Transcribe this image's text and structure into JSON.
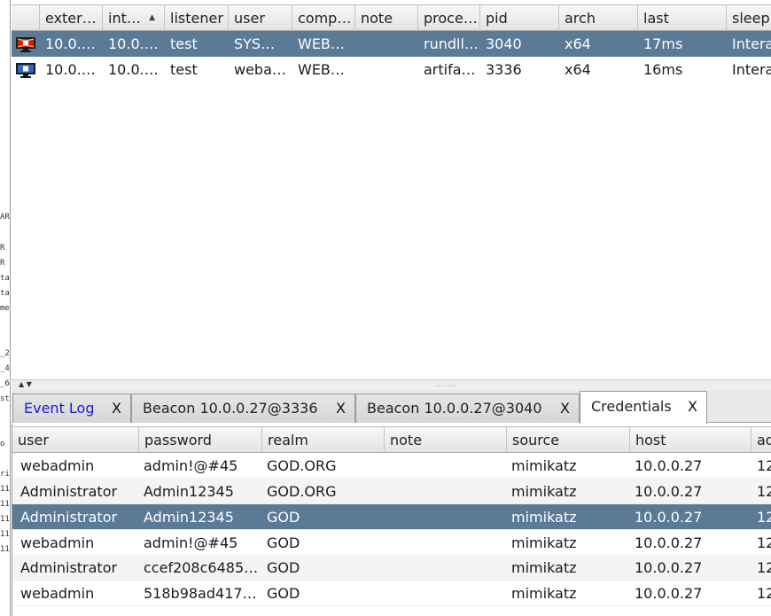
{
  "left_fragments": [
    "AR",
    "R",
    "R",
    "ta",
    "ta",
    "me",
    "_2",
    "_4",
    "_6",
    "st",
    "o",
    "ri",
    "11",
    "11",
    "11",
    "11",
    "11"
  ],
  "beacons": {
    "columns": [
      "exter…",
      "int…",
      "listener",
      "user",
      "comp…",
      "note",
      "proce…",
      "pid",
      "arch",
      "last",
      "sleep"
    ],
    "sort_indicator": "▲",
    "rows": [
      {
        "icon": "beacon-session-admin-icon",
        "external": "10.0.…",
        "internal": "10.0.…",
        "listener": "test",
        "user": "SYS…",
        "computer": "WEB…",
        "note": "",
        "process": "rundll…",
        "pid": "3040",
        "arch": "x64",
        "last": "17ms",
        "sleep": "Intera"
      },
      {
        "icon": "beacon-session-icon",
        "external": "10.0.…",
        "internal": "10.0.…",
        "listener": "test",
        "user": "weba…",
        "computer": "WEB…",
        "note": "",
        "process": "artifa…",
        "pid": "3336",
        "arch": "x64",
        "last": "16ms",
        "sleep": "Intera"
      }
    ]
  },
  "splitter": {
    "arrows": "▲ ▼",
    "grip": "......."
  },
  "tabs": [
    {
      "label": "Event Log",
      "close": "X"
    },
    {
      "label": "Beacon 10.0.0.27@3336",
      "close": "X"
    },
    {
      "label": "Beacon 10.0.0.27@3040",
      "close": "X"
    },
    {
      "label": "Credentials",
      "close": "X"
    }
  ],
  "credentials": {
    "columns": [
      "user",
      "password",
      "realm",
      "note",
      "source",
      "host",
      "ad"
    ],
    "rows": [
      {
        "user": "webadmin",
        "password": "admin!@#45",
        "realm": "GOD.ORG",
        "note": "",
        "source": "mimikatz",
        "host": "10.0.0.27",
        "added": "12"
      },
      {
        "user": "Administrator",
        "password": "Admin12345",
        "realm": "GOD.ORG",
        "note": "",
        "source": "mimikatz",
        "host": "10.0.0.27",
        "added": "12"
      },
      {
        "user": "Administrator",
        "password": "Admin12345",
        "realm": "GOD",
        "note": "",
        "source": "mimikatz",
        "host": "10.0.0.27",
        "added": "12"
      },
      {
        "user": "webadmin",
        "password": "admin!@#45",
        "realm": "GOD",
        "note": "",
        "source": "mimikatz",
        "host": "10.0.0.27",
        "added": "12"
      },
      {
        "user": "Administrator",
        "password": "ccef208c6485…",
        "realm": "GOD",
        "note": "",
        "source": "mimikatz",
        "host": "10.0.0.27",
        "added": "12"
      },
      {
        "user": "webadmin",
        "password": "518b98ad417…",
        "realm": "GOD",
        "note": "",
        "source": "mimikatz",
        "host": "10.0.0.27",
        "added": "12"
      }
    ]
  },
  "colors": {
    "selection": "#5b7a96",
    "link": "#1a1ad6"
  }
}
